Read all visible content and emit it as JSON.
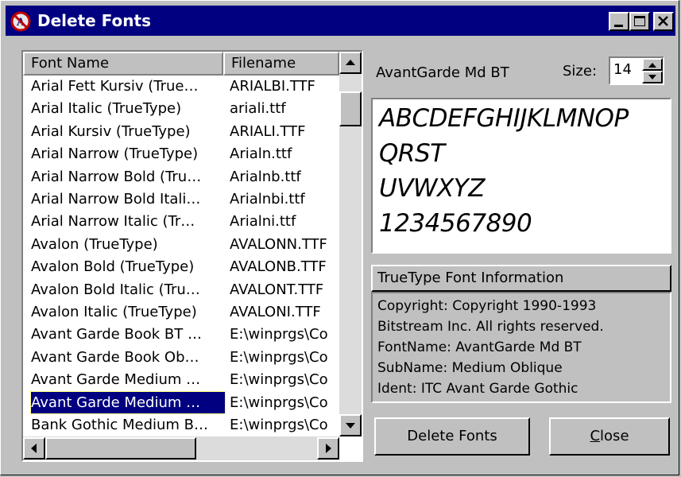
{
  "window": {
    "title": "Delete Fonts"
  },
  "fontList": {
    "columns": [
      "Font Name",
      "Filename"
    ],
    "rows": [
      {
        "name": "Arial Fett Kursiv (True…",
        "file": "ARIALBI.TTF"
      },
      {
        "name": "Arial Italic (TrueType)",
        "file": "ariali.ttf"
      },
      {
        "name": "Arial Kursiv (TrueType)",
        "file": "ARIALI.TTF"
      },
      {
        "name": "Arial Narrow (TrueType)",
        "file": "Arialn.ttf"
      },
      {
        "name": "Arial Narrow Bold (Tru…",
        "file": "Arialnb.ttf"
      },
      {
        "name": "Arial Narrow Bold Itali…",
        "file": "Arialnbi.ttf"
      },
      {
        "name": "Arial Narrow Italic (Tr…",
        "file": "Arialni.ttf"
      },
      {
        "name": "Avalon (TrueType)",
        "file": "AVALONN.TTF"
      },
      {
        "name": "Avalon Bold (TrueType)",
        "file": "AVALONB.TTF"
      },
      {
        "name": "Avalon Bold Italic (Tru…",
        "file": "AVALONT.TTF"
      },
      {
        "name": "Avalon Italic (TrueType)",
        "file": "AVALONI.TTF"
      },
      {
        "name": "Avant Garde Book BT …",
        "file": "E:\\winprgs\\Co"
      },
      {
        "name": "Avant Garde Book Ob…",
        "file": "E:\\winprgs\\Co"
      },
      {
        "name": "Avant Garde Medium …",
        "file": "E:\\winprgs\\Co"
      },
      {
        "name": "Avant Garde Medium …",
        "file": "E:\\winprgs\\Co"
      },
      {
        "name": "Bank Gothic Medium B…",
        "file": "E:\\winprgs\\Co"
      }
    ],
    "selectedIndex": 14
  },
  "preview": {
    "fontName": "AvantGarde Md BT",
    "sizeLabel": "Size:",
    "sizeValue": "14",
    "lines": [
      "ABCDEFGHIJKLMNOP",
      "QRST",
      "UVWXYZ",
      "1234567890"
    ]
  },
  "info": {
    "header": "TrueType Font Information",
    "lines": [
      "Copyright:  Copyright 1990-1993",
      "Bitstream Inc.  All rights reserved.",
      "FontName:  AvantGarde Md BT",
      "SubName:  Medium Oblique",
      "Ident:  ITC Avant Garde Gothic"
    ]
  },
  "buttons": {
    "delete": "Delete Fonts",
    "close_accel": "C",
    "close_rest": "lose"
  },
  "icons": {
    "app": "delete-fonts-icon",
    "minimize": "minimize-icon",
    "maximize": "maximize-icon",
    "close": "close-icon",
    "scrollUp": "scroll-up-icon",
    "scrollDown": "scroll-down-icon",
    "scrollLeft": "scroll-left-icon",
    "scrollRight": "scroll-right-icon"
  },
  "colors": {
    "titlebar": "#000080",
    "face": "#c0c0c0",
    "selection": "#000080"
  }
}
